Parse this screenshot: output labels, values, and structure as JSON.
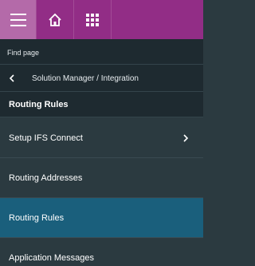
{
  "topbar": {
    "icons": [
      "menu-icon",
      "home-icon",
      "apps-grid-icon"
    ],
    "color": "#922d86"
  },
  "find_page": {
    "label": "Find page"
  },
  "breadcrumb": {
    "path": "Solution Manager / Integration"
  },
  "section": {
    "title": "Routing Rules"
  },
  "nav_items": [
    {
      "label": "Setup IFS Connect",
      "has_children": true,
      "active": false
    },
    {
      "label": "Routing Addresses",
      "has_children": false,
      "active": false
    },
    {
      "label": "Routing Rules",
      "has_children": false,
      "active": true
    },
    {
      "label": "Application Messages",
      "has_children": false,
      "active": false
    }
  ]
}
